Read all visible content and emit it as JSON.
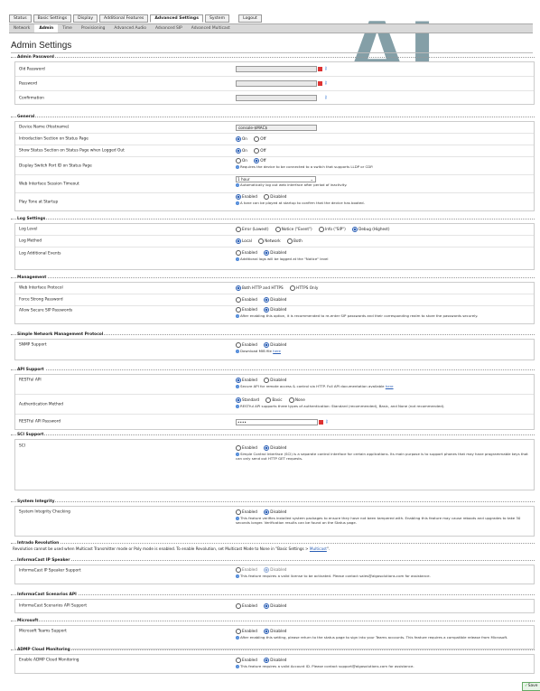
{
  "logo": {
    "text": "AL"
  },
  "top_tabs": [
    "Status",
    "Basic Settings",
    "Display",
    "Additional Features",
    "Advanced Settings",
    "System",
    "Logout"
  ],
  "sub_tabs": [
    "Network",
    "Admin",
    "Time",
    "Provisioning",
    "Advanced Audio",
    "Advanced SIP",
    "Advanced Multicast"
  ],
  "page_title": "Admin Settings",
  "admin_password": {
    "title": "Admin Password",
    "old_label": "Old Password",
    "password_label": "Password",
    "confirm_label": "Confirmation"
  },
  "general": {
    "title": "General",
    "device_name_label": "Device Name (Hostname)",
    "device_name_value": "console-$MAC$",
    "intro_label": "Introduction Section on Status Page",
    "status_logged_out_label": "Show Status Section on Status Page when Logged Out",
    "switch_port_label": "Display Switch Port ID on Status Page",
    "switch_port_note": "Requires the device to be connected to a switch that supports LLDP or CDP.",
    "timeout_label": "Web Interface Session Timeout",
    "timeout_value": "1 hour",
    "timeout_note": "Automatically log out web interface after period of inactivity.",
    "play_tone_label": "Play Tone at Startup",
    "play_tone_note": "A tone can be played at startup to confirm that the device has booted.",
    "on": "On",
    "off": "Off",
    "enabled": "Enabled",
    "disabled": "Disabled"
  },
  "log": {
    "title": "Log Settings",
    "level_label": "Log Level",
    "levels": [
      "Error (Lowest)",
      "Notice (\"Event\")",
      "Info (\"SIP\")",
      "Debug (Highest)"
    ],
    "method_label": "Log Method",
    "methods": [
      "Local",
      "Network",
      "Both"
    ],
    "additional_label": "Log Additional Events",
    "additional_note": "Additional logs will be logged at the \"Notice\" level"
  },
  "management": {
    "title": "Management",
    "protocol_label": "Web Interface Protocol",
    "protocols": [
      "Both HTTP and HTTPS",
      "HTTPS Only"
    ],
    "strong_pw_label": "Force Strong Password",
    "secure_sip_label": "Allow Secure SIP Passwords",
    "secure_sip_note": "After enabling this option, it is recommended to re-enter SIP passwords and their corresponding realm to store the passwords securely."
  },
  "snmp": {
    "title": "Simple Network Management Protocol",
    "support_label": "SNMP Support",
    "note_prefix": "Download MIB file ",
    "note_link": "here"
  },
  "api": {
    "title": "API Support",
    "restful_label": "RESTful API",
    "restful_note_prefix": "Secure API for remote access & control via HTTP. Full API documentation available ",
    "restful_note_link": "here",
    "auth_label": "Authentication Method",
    "auth_options": [
      "Standard",
      "Basic",
      "None"
    ],
    "auth_note": "RESTful API supports three types of authentication: Standard (recommended), Basic, and None (not recommended).",
    "password_label": "RESTful API Password",
    "password_value": "••••"
  },
  "sci": {
    "title": "SCI Support",
    "label": "SCI",
    "note": "Simple Control Interface (SCI) is a separate control interface for certain applications. Its main purpose is to support phones that may have programmable keys that can only send out HTTP GET requests."
  },
  "integrity": {
    "title": "System Integrity",
    "label": "System Integrity Checking",
    "note": "This feature verifies installed system packages to ensure they have not been tampered with. Enabling this feature may cause reboots and upgrades to take 30 seconds longer. Verification results can be found on the Status page."
  },
  "intrado": {
    "title": "Intrado Revolution",
    "note_prefix": "Revolution cannot be used when Multicast Transmitter mode or Poly mode is enabled. To enable Revolution, set Multicast Mode to None in \"Basic Settings > ",
    "note_link": "Multicast",
    "note_suffix": "\"."
  },
  "ic_speaker": {
    "title": "InformaCast IP Speaker",
    "label": "InformaCast IP Speaker Support",
    "note": "This feature requires a valid license to be activated. Please contact sales@algosolutions.com for assistance."
  },
  "ic_scenarios": {
    "title": "InformaCast Scenarios API",
    "label": "InformaCast Scenarios API Support"
  },
  "microsoft": {
    "title": "Microsoft",
    "label": "Microsoft Teams Support",
    "note": "After enabling this setting, please return to the status page to sign into your Teams accounts. This feature requires a compatible release from Microsoft."
  },
  "admp": {
    "title": "ADMP Cloud Monitoring",
    "label": "Enable ADMP Cloud Monitoring",
    "note": "This feature requires a valid Account ID. Please contact support@algosolutions.com for assistance."
  },
  "save_label": "Save"
}
